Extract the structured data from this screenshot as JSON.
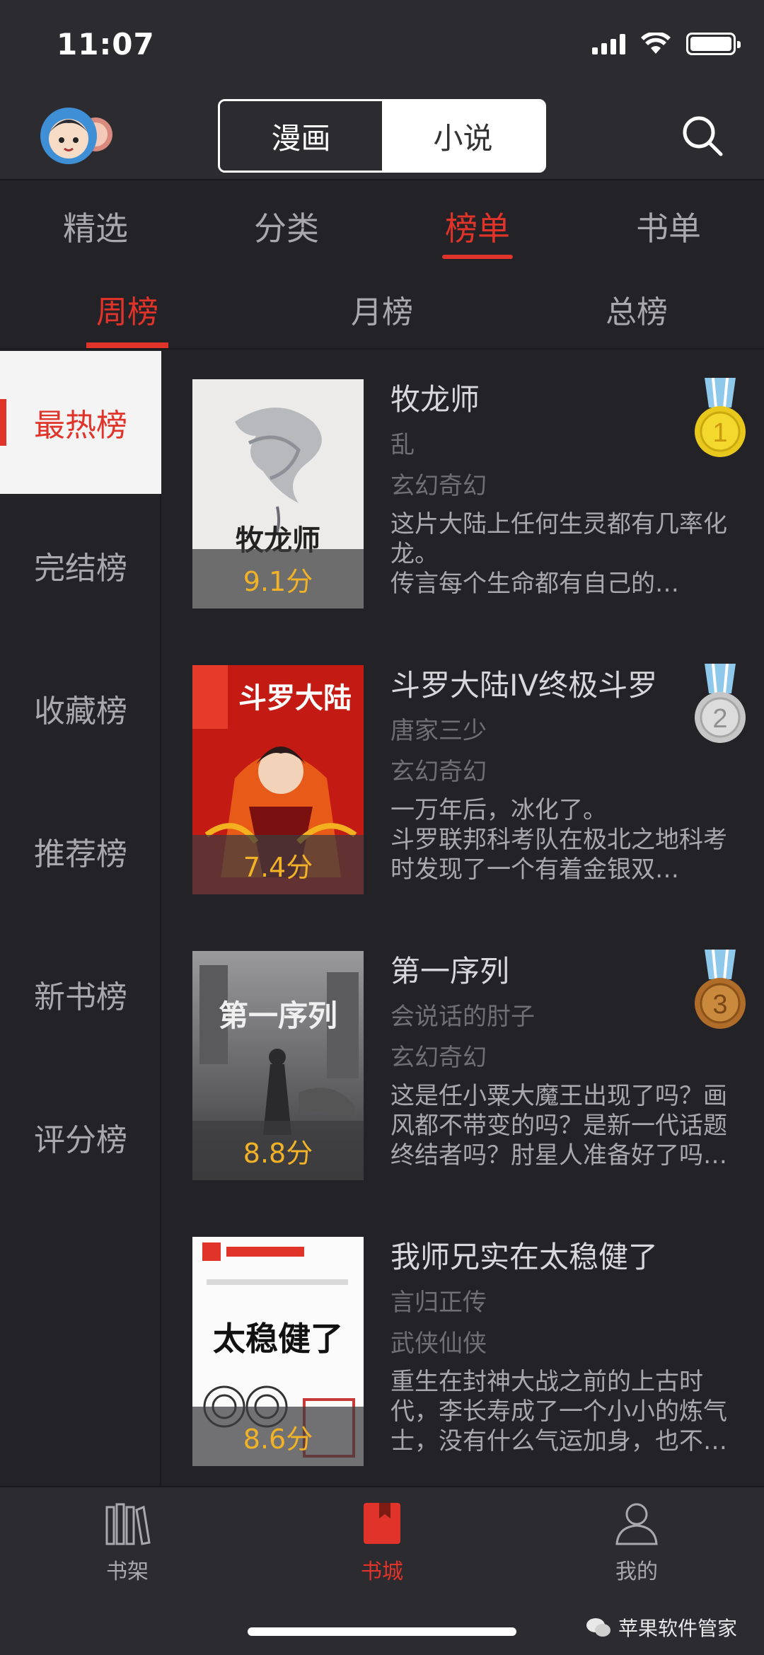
{
  "status": {
    "time": "11:07"
  },
  "header": {
    "segments": [
      {
        "label": "漫画"
      },
      {
        "label": "小说"
      }
    ],
    "active_segment": "小说"
  },
  "tabs": [
    {
      "label": "精选"
    },
    {
      "label": "分类"
    },
    {
      "label": "榜单"
    },
    {
      "label": "书单"
    }
  ],
  "active_tab": "榜单",
  "subtabs": [
    {
      "label": "周榜"
    },
    {
      "label": "月榜"
    },
    {
      "label": "总榜"
    }
  ],
  "active_subtab": "周榜",
  "sidebar": {
    "items": [
      {
        "label": "最热榜"
      },
      {
        "label": "完结榜"
      },
      {
        "label": "收藏榜"
      },
      {
        "label": "推荐榜"
      },
      {
        "label": "新书榜"
      },
      {
        "label": "评分榜"
      }
    ],
    "active": "最热榜"
  },
  "books": [
    {
      "title": "牧龙师",
      "author": "乱",
      "genre": "玄幻奇幻",
      "description": "这片大陆上任何生灵都有几率化龙。\n        传言每个生命都有自己的…",
      "score": "9.1分",
      "rank": "1",
      "cover_text": "牧龙师"
    },
    {
      "title": "斗罗大陆IV终极斗罗",
      "author": "唐家三少",
      "genre": "玄幻奇幻",
      "description": "一万年后，冰化了。\n        斗罗联邦科考队在极北之地科考时发现了一个有着金银双…",
      "score": "7.4分",
      "rank": "2",
      "cover_text": "斗罗大陆"
    },
    {
      "title": "第一序列",
      "author": "会说话的肘子",
      "genre": "玄幻奇幻",
      "description": "这是任小粟大魔王出现了吗？画风都不带变的吗？是新一代话题终结者吗？肘星人准备好了吗…",
      "score": "8.8分",
      "rank": "3",
      "cover_text": "第一序列"
    },
    {
      "title": "我师兄实在太稳健了",
      "author": "言归正传",
      "genre": "武侠仙侠",
      "description": "重生在封神大战之前的上古时代，李长寿成了一个小小的炼气士，没有什么气运加身，也不…",
      "score": "8.6分",
      "rank": "",
      "cover_text": "太稳健了"
    }
  ],
  "bottom_nav": [
    {
      "label": "书架"
    },
    {
      "label": "书城"
    },
    {
      "label": "我的"
    }
  ],
  "active_nav": "书城",
  "watermark": "苹果软件管家",
  "colors": {
    "accent": "#e0342a",
    "score": "#f2b227",
    "gold": "#e8c81c",
    "silver": "#c6c6c6",
    "bronze": "#b06d2a"
  }
}
